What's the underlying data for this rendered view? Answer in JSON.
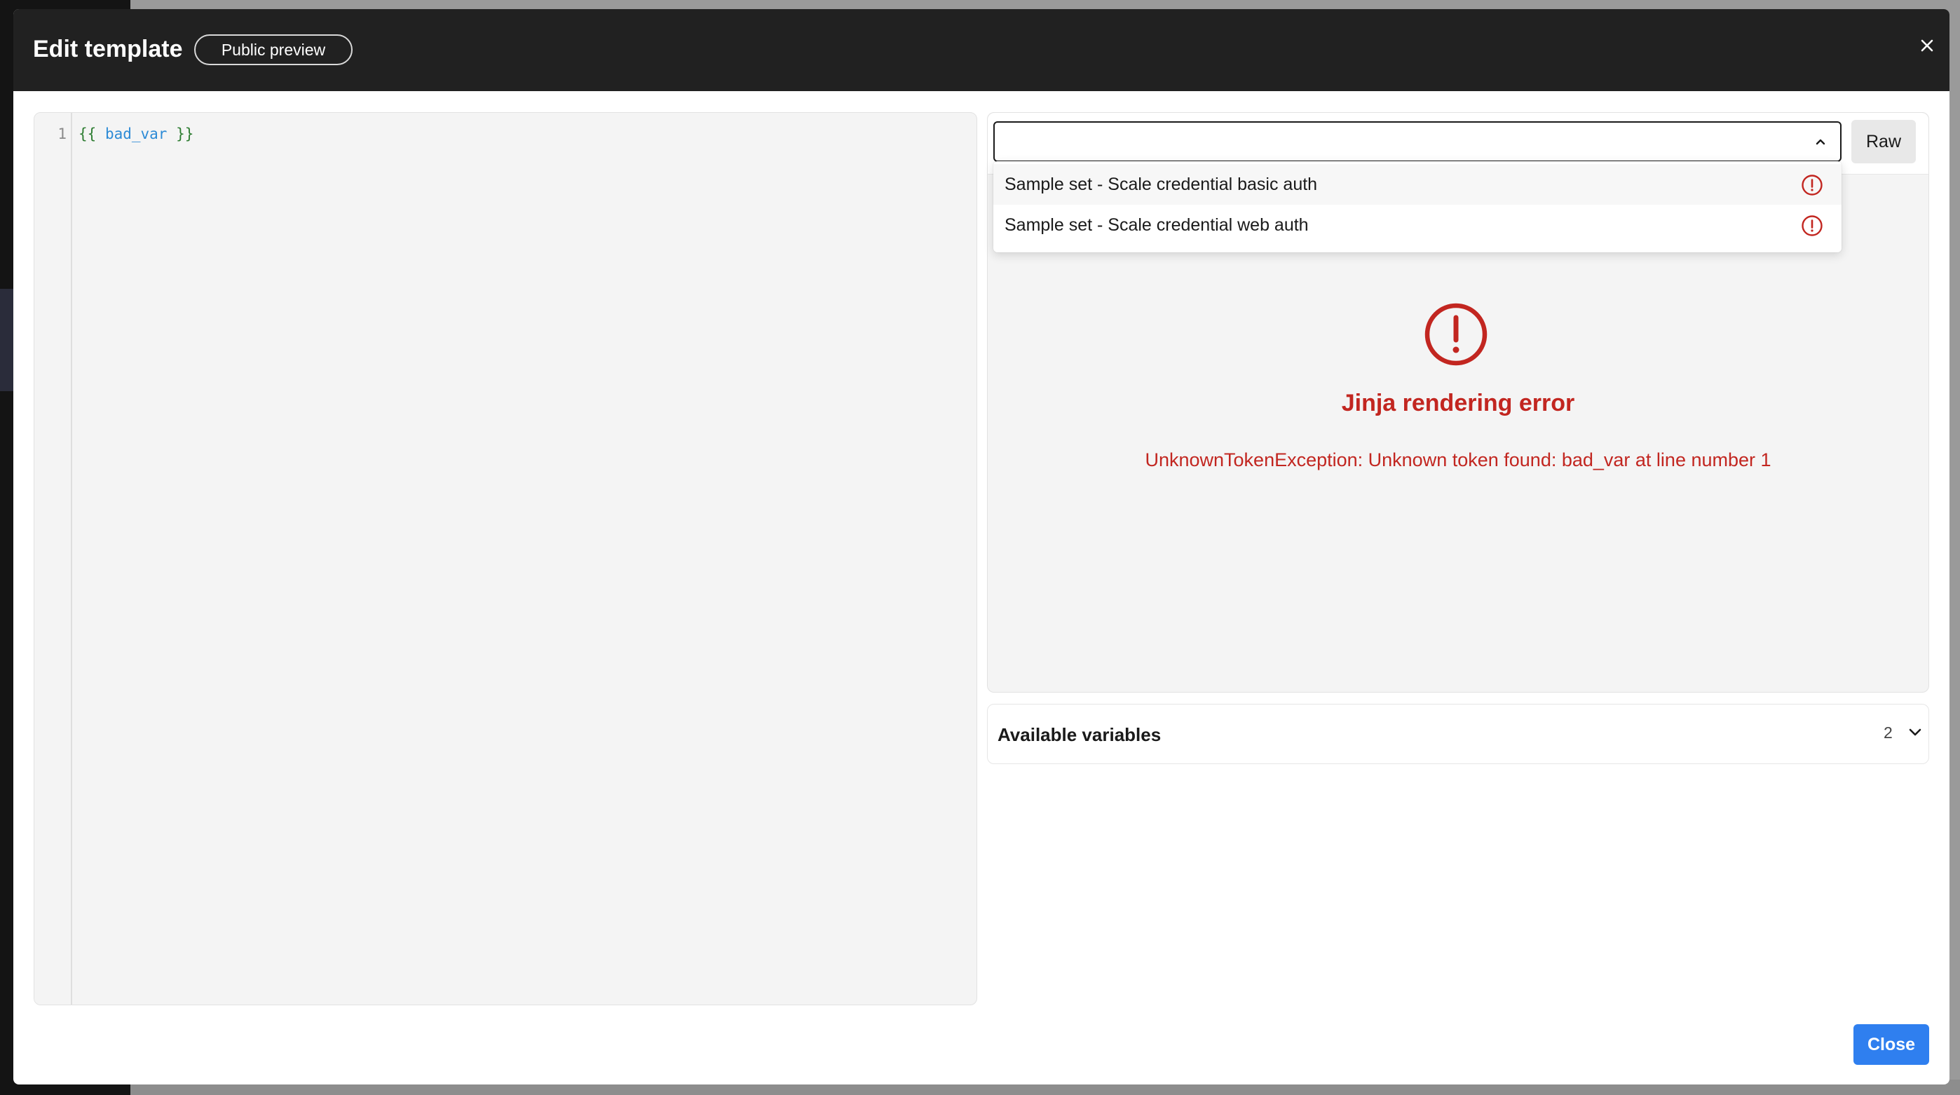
{
  "modal": {
    "title": "Edit template",
    "badge": "Public preview",
    "close_icon": "close-icon"
  },
  "editor": {
    "line_number": "1",
    "code_open": "{{",
    "code_var": "bad_var",
    "code_close": "}}"
  },
  "preview": {
    "select_value": "",
    "raw_label": "Raw",
    "dropdown_options": [
      {
        "label": "Sample set - Scale credential basic auth",
        "icon": "error-circle-icon"
      },
      {
        "label": "Sample set - Scale credential web auth",
        "icon": "error-circle-icon"
      }
    ],
    "error_icon": "error-circle-icon",
    "error_title": "Jinja rendering error",
    "error_message": "UnknownTokenException: Unknown token found: bad_var at line number 1"
  },
  "variables": {
    "title": "Available variables",
    "count": "2",
    "chevron_icon": "chevron-down-icon"
  },
  "footer": {
    "close_label": "Close"
  },
  "colors": {
    "header_bg": "#212121",
    "error": "#c22620",
    "accent": "#2f7fef"
  }
}
